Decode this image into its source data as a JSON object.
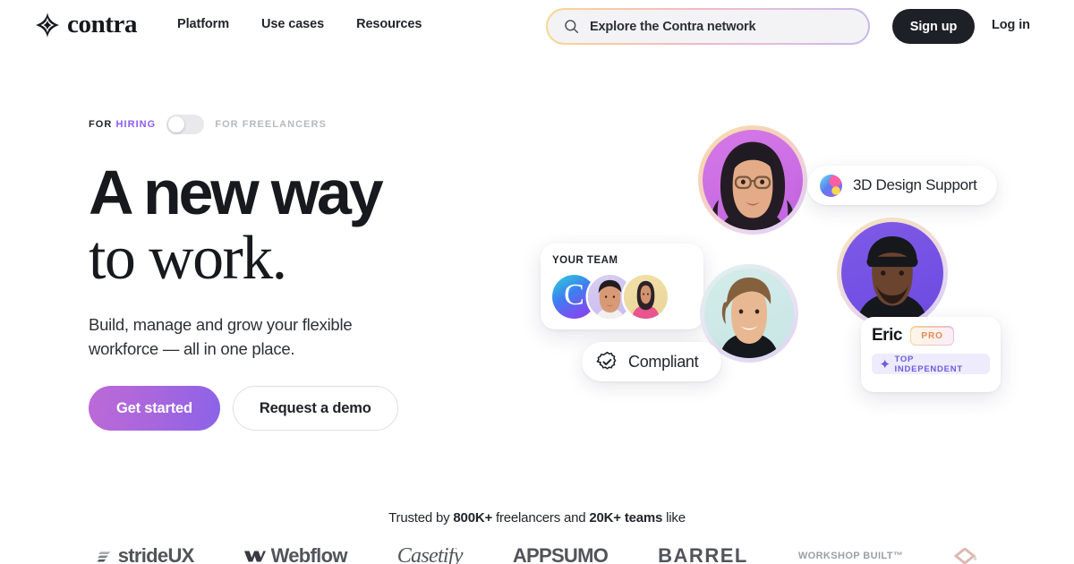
{
  "header": {
    "brand_name": "contra",
    "brand_icon": "contra-star-icon",
    "nav": [
      {
        "label": "Platform"
      },
      {
        "label": "Use cases"
      },
      {
        "label": "Resources"
      }
    ],
    "search": {
      "icon": "search-icon",
      "placeholder": "Explore the Contra network",
      "value": ""
    },
    "signup_label": "Sign up",
    "login_label": "Log in"
  },
  "hero": {
    "toggle": {
      "left_prefix": "FOR",
      "left_emphasis": "HIRING",
      "right_label": "FOR FREELANCERS",
      "state": "off"
    },
    "headline_line1": "A new way",
    "headline_line2": "to work.",
    "subheadline": "Build, manage and grow your flexible workforce — all in one place.",
    "primary_cta": "Get started",
    "secondary_cta": "Request a demo"
  },
  "art": {
    "chip_3d": {
      "label": "3D Design Support",
      "icon": "gradient-orb-icon"
    },
    "chip_compliant": {
      "label": "Compliant",
      "icon": "verified-badge-icon"
    },
    "team_card": {
      "title": "YOUR TEAM",
      "logo_letter": "C",
      "avatars": [
        "contra-logo-avatar",
        "team-member-avatar-1",
        "team-member-avatar-2"
      ]
    },
    "eric_card": {
      "name": "Eric",
      "pro_badge": "PRO",
      "top_badge": "TOP INDEPENDENT",
      "top_badge_icon": "contra-star-icon"
    }
  },
  "trusted": {
    "prefix": "Trusted by ",
    "count_freelancers": "800K+",
    "middle": " freelancers and ",
    "count_teams": "20K+ teams",
    "suffix": " like",
    "logos": [
      {
        "name": "strideUX",
        "style": "bold"
      },
      {
        "name": "Webflow",
        "style": "bold"
      },
      {
        "name": "Casetify",
        "style": "serif"
      },
      {
        "name": "APPSUMO",
        "style": "bold"
      },
      {
        "name": "BARREL",
        "style": "wide"
      },
      {
        "name": "WORKSHOP BUILT™",
        "style": "small"
      },
      {
        "name": "diamond-logo",
        "style": "mark"
      }
    ]
  },
  "colors": {
    "brand_dark": "#1d2127",
    "accent_purple": "#8b5cf6",
    "cta_gradient_start": "#bd6ad6",
    "cta_gradient_end": "#8a63e8",
    "pro_text": "#e08a55",
    "top_independent": "#6c5ce0",
    "page_bg": "#ffffff"
  }
}
